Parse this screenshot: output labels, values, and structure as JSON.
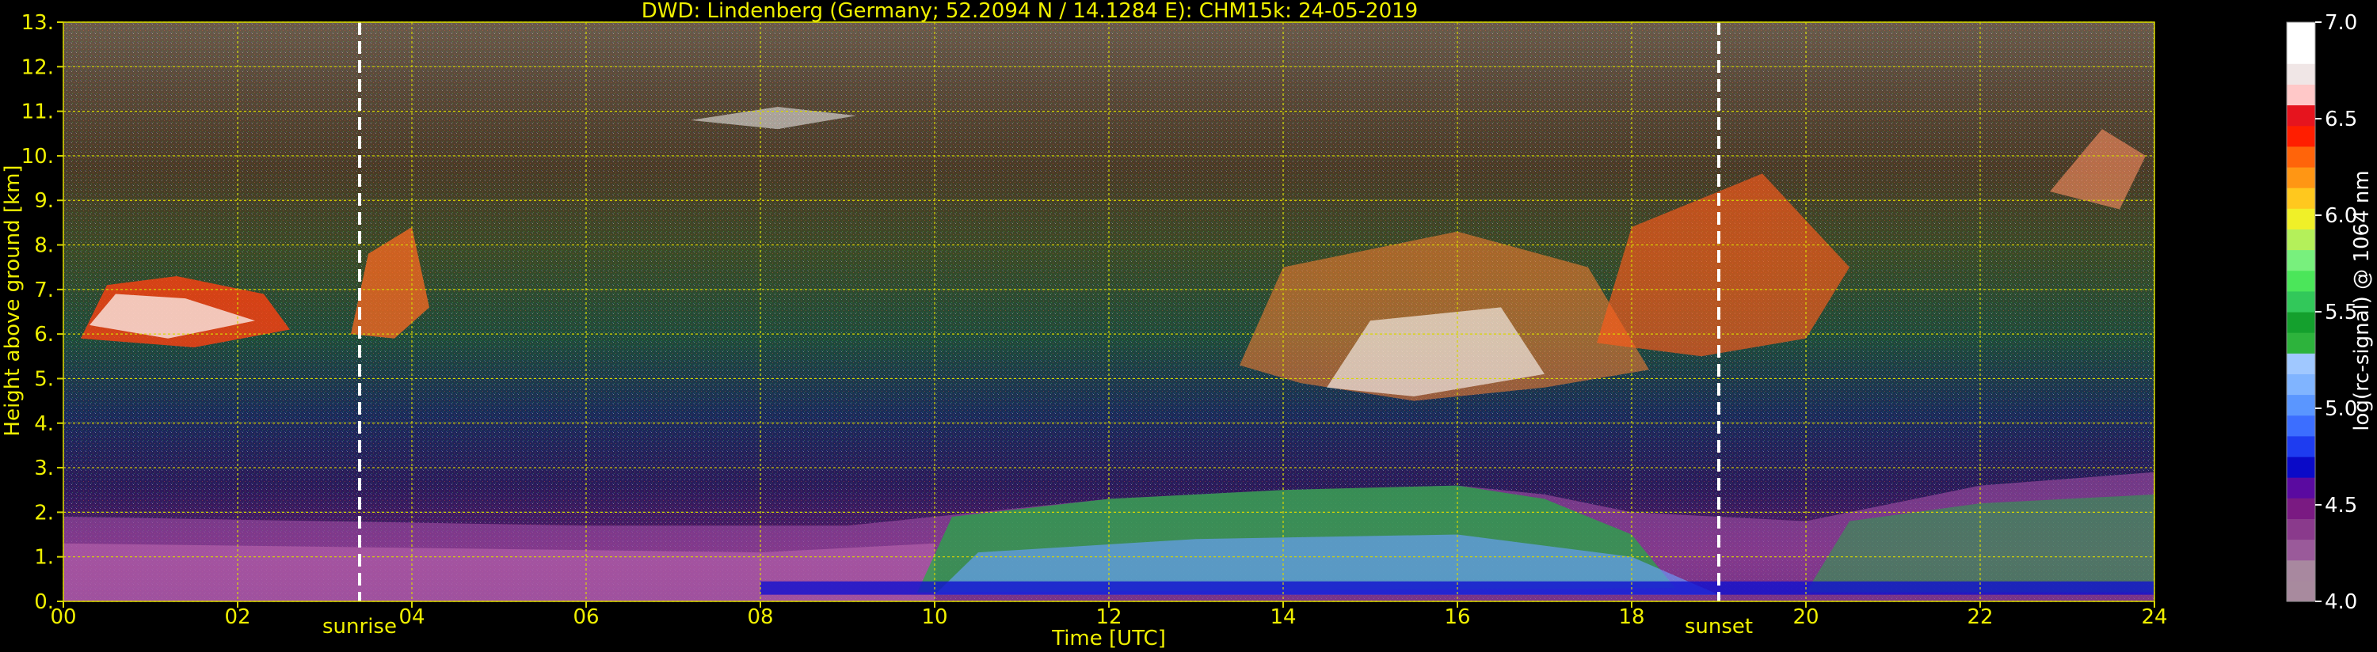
{
  "chart_data": {
    "type": "heatmap",
    "title": "DWD: Lindenberg (Germany; 52.2094 N / 14.1284 E):     CHM15k: 24-05-2019",
    "xlabel": "Time [UTC]",
    "ylabel": "Height above ground [km]",
    "xlim": [
      0,
      24
    ],
    "ylim": [
      0,
      13
    ],
    "x_ticks": [
      0,
      2,
      4,
      6,
      8,
      10,
      12,
      14,
      16,
      18,
      20,
      22,
      24
    ],
    "x_tick_labels": [
      "00",
      "02",
      "04",
      "06",
      "08",
      "10",
      "12",
      "14",
      "16",
      "18",
      "20",
      "22",
      "24"
    ],
    "y_ticks": [
      0,
      1,
      2,
      3,
      4,
      5,
      6,
      7,
      8,
      9,
      10,
      11,
      12,
      13
    ],
    "y_tick_labels": [
      "0.",
      "1.",
      "2.",
      "3.",
      "4.",
      "5.",
      "6.",
      "7.",
      "8.",
      "9.",
      "10.",
      "11.",
      "12.",
      "13."
    ],
    "grid": true,
    "events": [
      {
        "name": "sunrise",
        "time": 3.4
      },
      {
        "name": "sunset",
        "time": 19.0
      }
    ],
    "colorbar": {
      "label": "log(rc-signal) @ 1064 nm",
      "range": [
        4.0,
        7.0
      ],
      "ticks": [
        4.0,
        4.5,
        5.0,
        5.5,
        6.0,
        6.5,
        7.0
      ],
      "tick_labels": [
        "4.0",
        "4.5",
        "5.0",
        "5.5",
        "6.0",
        "6.5",
        "7.0"
      ],
      "colors": [
        "#a88a9e",
        "#a8889f",
        "#9a5a9a",
        "#8a3a8c",
        "#7a1a82",
        "#5a0aa0",
        "#0a0ac8",
        "#1e3cf0",
        "#3c6eff",
        "#5a96ff",
        "#80b4ff",
        "#a0c8ff",
        "#2db33c",
        "#14a02d",
        "#32c85a",
        "#4be65a",
        "#78f07d",
        "#b4f05a",
        "#f0f028",
        "#ffc81e",
        "#ff9614",
        "#ff640a",
        "#ff1e00",
        "#e6141e",
        "#ffc8c8",
        "#f0e6e6",
        "#ffffff",
        "#ffffff"
      ]
    },
    "features": [
      {
        "layer": "boundary-layer",
        "description": "strong aerosol signal below ~1.5 km all day; mixed layer grows to ~2.5 km 10-18 UTC"
      },
      {
        "layer": "cirrus",
        "description": "ice clouds ~5.5-8 km in morning (00-05 UTC) and afternoon (13-20 UTC); upper traces near 9-11 km"
      }
    ]
  }
}
